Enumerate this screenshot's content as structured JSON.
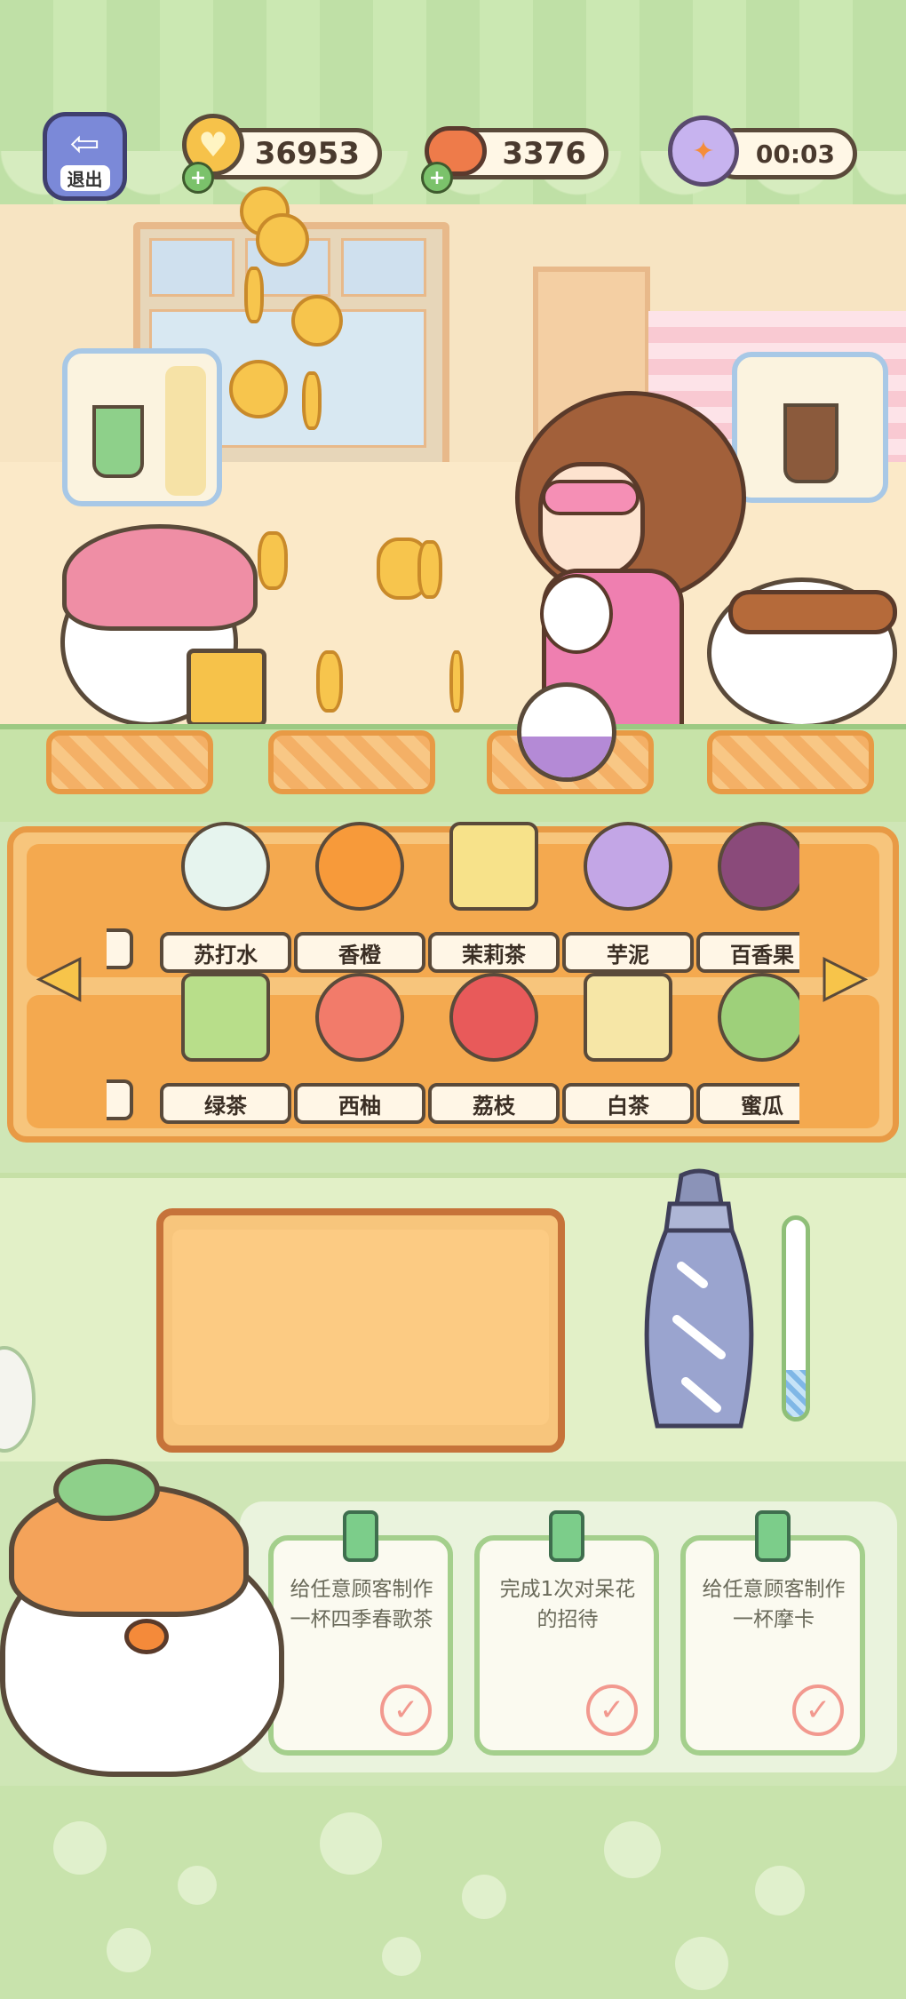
{
  "hud": {
    "exit_label": "退出",
    "coins": "36953",
    "meat": "3376",
    "timer": "00:03"
  },
  "ingredients": {
    "row1": [
      {
        "name": "苏打水",
        "color": "#e6f4ee"
      },
      {
        "name": "香橙",
        "color": "#f79a3a"
      },
      {
        "name": "茉莉茶",
        "color": "#f7e28a"
      },
      {
        "name": "芋泥",
        "color": "#c3a6e6"
      },
      {
        "name": "百香果",
        "color": "#8a4a7a"
      }
    ],
    "row2": [
      {
        "name": "绿茶",
        "color": "#b8de8a"
      },
      {
        "name": "西柚",
        "color": "#f27b6a"
      },
      {
        "name": "荔枝",
        "color": "#e85a5a"
      },
      {
        "name": "白茶",
        "color": "#f6e6a6"
      },
      {
        "name": "蜜瓜",
        "color": "#9ed07a"
      }
    ]
  },
  "tasks": [
    {
      "text": "给任意顾客制作一杯四季春歌茶"
    },
    {
      "text": "完成1次对呆花的招待"
    },
    {
      "text": "给任意顾客制作一杯摩卡"
    }
  ],
  "shaker_fill": 0.24,
  "colors": {
    "accent": "#f4a94f",
    "border": "#5a4a3a",
    "counter": "#c7e3a8"
  }
}
